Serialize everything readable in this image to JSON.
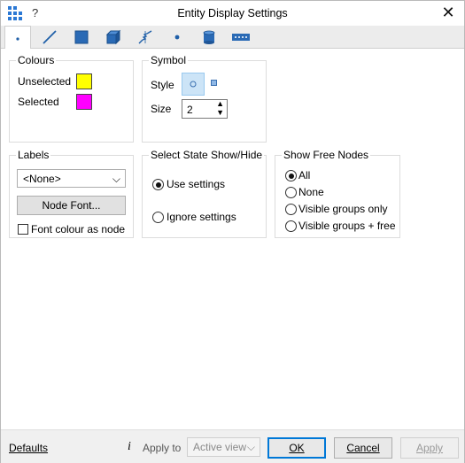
{
  "window": {
    "title": "Entity Display Settings",
    "help": "?"
  },
  "tabs": [
    {
      "name": "nodes",
      "icon": "node-dot-icon",
      "active": true
    },
    {
      "name": "lines",
      "icon": "line-icon",
      "active": false
    },
    {
      "name": "surfaces",
      "icon": "square-icon",
      "active": false
    },
    {
      "name": "volumes",
      "icon": "cube-icon",
      "active": false
    },
    {
      "name": "springs",
      "icon": "spring-icon",
      "active": false
    },
    {
      "name": "points",
      "icon": "point-icon",
      "active": false
    },
    {
      "name": "cylinders",
      "icon": "cylinder-icon",
      "active": false
    },
    {
      "name": "dotted",
      "icon": "dotted-line-icon",
      "active": false
    }
  ],
  "colours": {
    "title": "Colours",
    "unselected_label": "Unselected",
    "unselected_color": "#ffff00",
    "selected_label": "Selected",
    "selected_color": "#ff00ff"
  },
  "symbol": {
    "title": "Symbol",
    "style_label": "Style",
    "size_label": "Size",
    "size_value": "2"
  },
  "labels": {
    "title": "Labels",
    "combo_value": "<None>",
    "font_button": "Node Font...",
    "font_colour_label": "Font colour as node"
  },
  "select_state": {
    "title": "Select State Show/Hide",
    "options": [
      "Use settings",
      "Ignore settings"
    ],
    "selected": 0
  },
  "free_nodes": {
    "title": "Show Free Nodes",
    "options": [
      "All",
      "None",
      "Visible groups only",
      "Visible groups + free"
    ],
    "selected": 0
  },
  "footer": {
    "defaults": "Defaults",
    "info_icon": "i",
    "apply_to_label": "Apply to",
    "apply_to_value": "Active view",
    "ok": "OK",
    "cancel": "Cancel",
    "apply": "Apply"
  }
}
